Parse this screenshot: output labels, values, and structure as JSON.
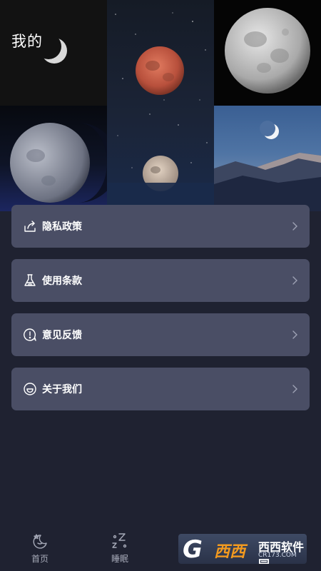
{
  "header": {
    "title": "我的"
  },
  "menu": {
    "items": [
      {
        "label": "隐私政策",
        "icon": "share-arrow-icon"
      },
      {
        "label": "使用条款",
        "icon": "flask-icon"
      },
      {
        "label": "意见反馈",
        "icon": "exclamation-bubble-icon"
      },
      {
        "label": "关于我们",
        "icon": "smile-icon"
      }
    ]
  },
  "tabbar": {
    "tabs": [
      {
        "label": "首页",
        "icon": "moon-star-icon"
      },
      {
        "label": "睡眠",
        "icon": "sleep-zzz-icon"
      }
    ]
  },
  "watermark": {
    "brand": "西西软件园",
    "url": "CR173.COM"
  },
  "colors": {
    "background": "#1f2231",
    "card": "#4a4e65",
    "tab_label": "#a6aab8",
    "watermark_orange": "#f39a1f"
  }
}
